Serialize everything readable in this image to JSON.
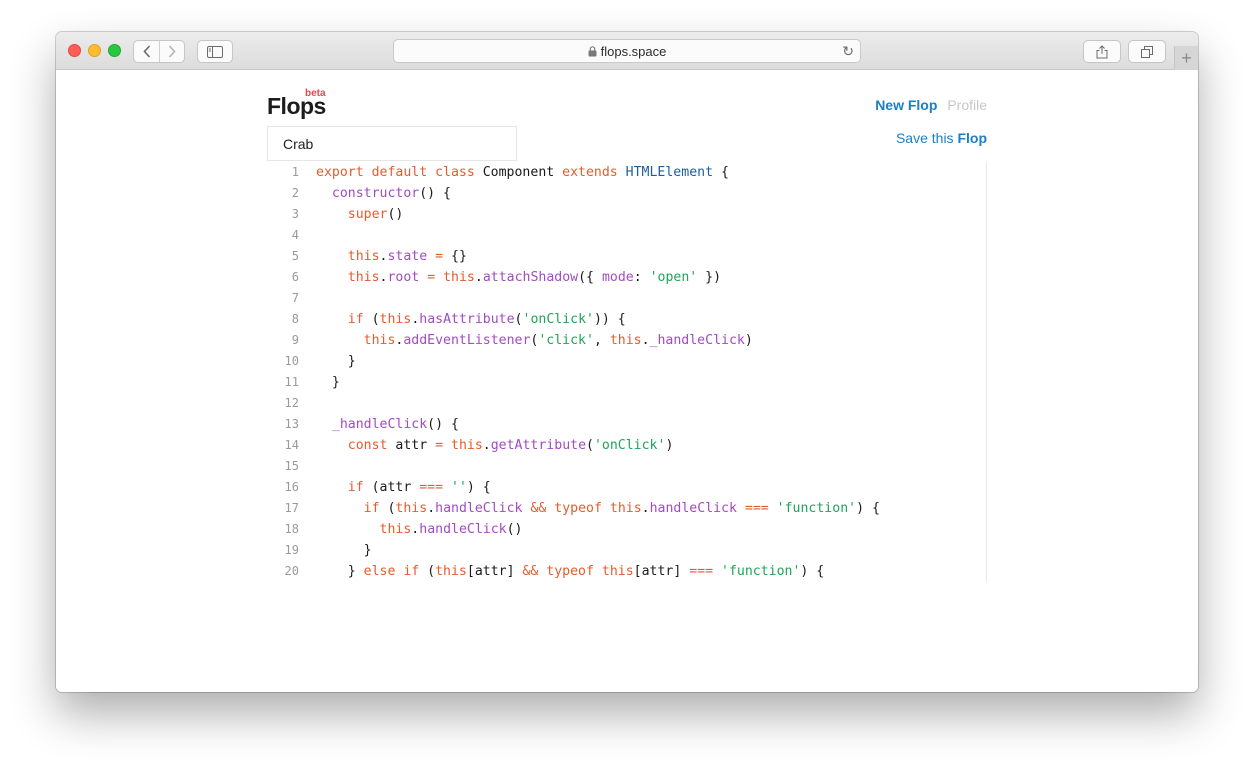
{
  "browser": {
    "url": "flops.space",
    "back_label": "‹",
    "forward_label": "›"
  },
  "app": {
    "logo": "Flops",
    "badge": "beta",
    "nav": {
      "new_flop": "New Flop",
      "profile": "Profile"
    },
    "flop_name": "Crab",
    "save": {
      "prefix": "Save this ",
      "emphasis": "Flop"
    }
  },
  "code": {
    "line_numbers": [
      "1",
      "2",
      "3",
      "4",
      "5",
      "6",
      "7",
      "8",
      "9",
      "10",
      "11",
      "12",
      "13",
      "14",
      "15",
      "16",
      "17",
      "18",
      "19",
      "20"
    ],
    "lines": [
      [
        {
          "t": "export default class",
          "c": "kw"
        },
        {
          "t": " Component "
        },
        {
          "t": "extends",
          "c": "kw"
        },
        {
          "t": " "
        },
        {
          "t": "HTMLElement",
          "c": "typ"
        },
        {
          "t": " {"
        }
      ],
      [
        {
          "t": "  "
        },
        {
          "t": "constructor",
          "c": "fn"
        },
        {
          "t": "() {"
        }
      ],
      [
        {
          "t": "    "
        },
        {
          "t": "super",
          "c": "kw"
        },
        {
          "t": "()"
        }
      ],
      [],
      [
        {
          "t": "    "
        },
        {
          "t": "this",
          "c": "kw"
        },
        {
          "t": "."
        },
        {
          "t": "state",
          "c": "fn"
        },
        {
          "t": " "
        },
        {
          "t": "=",
          "c": "kw"
        },
        {
          "t": " {}"
        }
      ],
      [
        {
          "t": "    "
        },
        {
          "t": "this",
          "c": "kw"
        },
        {
          "t": "."
        },
        {
          "t": "root",
          "c": "fn"
        },
        {
          "t": " "
        },
        {
          "t": "=",
          "c": "kw"
        },
        {
          "t": " "
        },
        {
          "t": "this",
          "c": "kw"
        },
        {
          "t": "."
        },
        {
          "t": "attachShadow",
          "c": "fn"
        },
        {
          "t": "({ "
        },
        {
          "t": "mode",
          "c": "fn"
        },
        {
          "t": ": "
        },
        {
          "t": "'open'",
          "c": "str"
        },
        {
          "t": " })"
        }
      ],
      [],
      [
        {
          "t": "    "
        },
        {
          "t": "if",
          "c": "kw"
        },
        {
          "t": " ("
        },
        {
          "t": "this",
          "c": "kw"
        },
        {
          "t": "."
        },
        {
          "t": "hasAttribute",
          "c": "fn"
        },
        {
          "t": "("
        },
        {
          "t": "'onClick'",
          "c": "str"
        },
        {
          "t": ")) {"
        }
      ],
      [
        {
          "t": "      "
        },
        {
          "t": "this",
          "c": "kw"
        },
        {
          "t": "."
        },
        {
          "t": "addEventListener",
          "c": "fn"
        },
        {
          "t": "("
        },
        {
          "t": "'click'",
          "c": "str"
        },
        {
          "t": ", "
        },
        {
          "t": "this",
          "c": "kw"
        },
        {
          "t": "."
        },
        {
          "t": "_handleClick",
          "c": "fn"
        },
        {
          "t": ")"
        }
      ],
      [
        {
          "t": "    }"
        }
      ],
      [
        {
          "t": "  }"
        }
      ],
      [],
      [
        {
          "t": "  "
        },
        {
          "t": "_handleClick",
          "c": "fn"
        },
        {
          "t": "() {"
        }
      ],
      [
        {
          "t": "    "
        },
        {
          "t": "const",
          "c": "kw"
        },
        {
          "t": " attr "
        },
        {
          "t": "=",
          "c": "kw"
        },
        {
          "t": " "
        },
        {
          "t": "this",
          "c": "kw"
        },
        {
          "t": "."
        },
        {
          "t": "getAttribute",
          "c": "fn"
        },
        {
          "t": "("
        },
        {
          "t": "'onClick'",
          "c": "str"
        },
        {
          "t": ")"
        }
      ],
      [],
      [
        {
          "t": "    "
        },
        {
          "t": "if",
          "c": "kw"
        },
        {
          "t": " (attr "
        },
        {
          "t": "===",
          "c": "kw"
        },
        {
          "t": " "
        },
        {
          "t": "''",
          "c": "str"
        },
        {
          "t": ") {"
        }
      ],
      [
        {
          "t": "      "
        },
        {
          "t": "if",
          "c": "kw"
        },
        {
          "t": " ("
        },
        {
          "t": "this",
          "c": "kw"
        },
        {
          "t": "."
        },
        {
          "t": "handleClick",
          "c": "fn"
        },
        {
          "t": " "
        },
        {
          "t": "&&",
          "c": "kw"
        },
        {
          "t": " "
        },
        {
          "t": "typeof",
          "c": "kw"
        },
        {
          "t": " "
        },
        {
          "t": "this",
          "c": "kw"
        },
        {
          "t": "."
        },
        {
          "t": "handleClick",
          "c": "fn"
        },
        {
          "t": " "
        },
        {
          "t": "===",
          "c": "kw"
        },
        {
          "t": " "
        },
        {
          "t": "'function'",
          "c": "str"
        },
        {
          "t": ") {"
        }
      ],
      [
        {
          "t": "        "
        },
        {
          "t": "this",
          "c": "kw"
        },
        {
          "t": "."
        },
        {
          "t": "handleClick",
          "c": "fn"
        },
        {
          "t": "()"
        }
      ],
      [
        {
          "t": "      }"
        }
      ],
      [
        {
          "t": "    } "
        },
        {
          "t": "else if",
          "c": "kw"
        },
        {
          "t": " ("
        },
        {
          "t": "this",
          "c": "kw"
        },
        {
          "t": "[attr] "
        },
        {
          "t": "&&",
          "c": "kw"
        },
        {
          "t": " "
        },
        {
          "t": "typeof",
          "c": "kw"
        },
        {
          "t": " "
        },
        {
          "t": "this",
          "c": "kw"
        },
        {
          "t": "[attr] "
        },
        {
          "t": "===",
          "c": "kw"
        },
        {
          "t": " "
        },
        {
          "t": "'function'",
          "c": "str"
        },
        {
          "t": ") {"
        }
      ]
    ]
  },
  "colors": {
    "keyword": "#e55c2e",
    "function": "#a24bc2",
    "string": "#20a35b",
    "type": "#1f5e9e",
    "link": "#1b7fc4",
    "badge": "#e8474b"
  }
}
